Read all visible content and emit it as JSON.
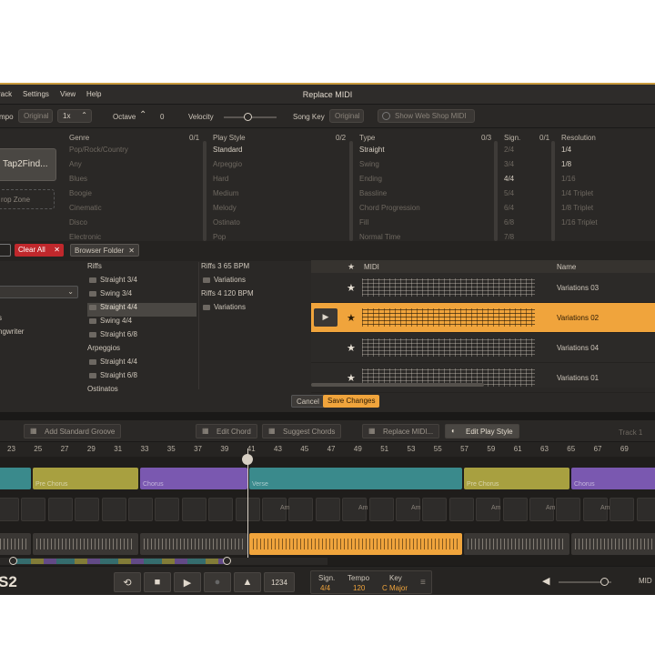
{
  "menu": [
    "rack",
    "Settings",
    "View",
    "Help"
  ],
  "dialog_title": "Replace MIDI",
  "options": {
    "tempo_label": "mpo",
    "tempo_value": "Original",
    "tempo_mult": "1x",
    "octave_label": "Octave",
    "octave_value": "0",
    "velocity_label": "Velocity",
    "velocity_level": 0.45,
    "song_key_label": "Song Key",
    "song_key_value": "Original",
    "web_shop": "Show Web Shop MIDI"
  },
  "left_panel": {
    "tap_button": "Tap2Find...",
    "drop_zone": "rop Zone"
  },
  "columns": [
    {
      "title": "Genre",
      "count": "0/1",
      "items": [
        "Pop/Rock/Country",
        "Any",
        "Blues",
        "Boogie",
        "Cinematic",
        "Disco",
        "Electronic"
      ],
      "active": []
    },
    {
      "title": "Play Style",
      "count": "0/2",
      "items": [
        "Standard",
        "Arpeggio",
        "Hard",
        "Medium",
        "Melody",
        "Ostinato",
        "Pop"
      ],
      "active": [
        0
      ]
    },
    {
      "title": "Type",
      "count": "0/3",
      "items": [
        "Straight",
        "Swing",
        "Ending",
        "Bassline",
        "Chord Progression",
        "Fill",
        "Normal Time"
      ],
      "active": [
        0
      ]
    },
    {
      "title": "Sign.",
      "count": "0/1",
      "items": [
        "2/4",
        "3/4",
        "4/4",
        "5/4",
        "6/4",
        "6/8",
        "7/8"
      ],
      "active": [
        2
      ]
    },
    {
      "title": "Resolution",
      "count": "",
      "items": [
        "1/4",
        "1/8",
        "1/16",
        "1/4 Triplet",
        "1/8 Triplet",
        "1/16 Triplet"
      ],
      "active": [
        0,
        1
      ]
    }
  ],
  "filter": {
    "clear_all": "Clear All",
    "browser_folder": "Browser Folder"
  },
  "left_tree": [
    "s",
    "ngwriter"
  ],
  "folder_tree": [
    {
      "label": "Riffs",
      "level": 0,
      "folder": false,
      "selected": false
    },
    {
      "label": "Straight 3/4",
      "level": 1,
      "folder": true,
      "selected": false
    },
    {
      "label": "Swing 3/4",
      "level": 1,
      "folder": true,
      "selected": false
    },
    {
      "label": "Straight 4/4",
      "level": 1,
      "folder": true,
      "selected": true
    },
    {
      "label": "Swing 4/4",
      "level": 1,
      "folder": true,
      "selected": false
    },
    {
      "label": "Straight 6/8",
      "level": 1,
      "folder": true,
      "selected": false
    },
    {
      "label": "Arpeggios",
      "level": 0,
      "folder": false,
      "selected": false
    },
    {
      "label": "Straight 4/4",
      "level": 1,
      "folder": true,
      "selected": false
    },
    {
      "label": "Straight 6/8",
      "level": 1,
      "folder": true,
      "selected": false
    },
    {
      "label": "Ostinatos",
      "level": 0,
      "folder": false,
      "selected": false
    }
  ],
  "riffs_tree": [
    {
      "label": "Riffs 3 65 BPM",
      "folder": false
    },
    {
      "label": "Variations",
      "folder": true
    },
    {
      "label": "Riffs 4 120 BPM",
      "folder": false
    },
    {
      "label": "Variations",
      "folder": true
    }
  ],
  "midi_list": {
    "col_midi": "MIDI",
    "col_name": "Name",
    "rows": [
      {
        "name": "Variations 03",
        "selected": false
      },
      {
        "name": "Variations 02",
        "selected": true
      },
      {
        "name": "Variations 04",
        "selected": false
      },
      {
        "name": "Variations 01",
        "selected": false
      }
    ]
  },
  "dialog_buttons": {
    "cancel": "Cancel",
    "save": "Save Changes"
  },
  "toolbar": {
    "add_groove": "Add Standard Groove",
    "edit_chord": "Edit Chord",
    "suggest": "Suggest Chords",
    "replace": "Replace MIDI...",
    "edit_play_style": "Edit Play Style",
    "track": "Track 1"
  },
  "ruler": [
    "23",
    "25",
    "27",
    "29",
    "31",
    "33",
    "35",
    "37",
    "39",
    "41",
    "43",
    "45",
    "47",
    "49",
    "51",
    "53",
    "55",
    "57",
    "59",
    "61",
    "63",
    "65",
    "67",
    "69"
  ],
  "sections": [
    {
      "label": "",
      "color": "#3a8a8c"
    },
    {
      "label": "Pre Chorus",
      "color": "#a8a040"
    },
    {
      "label": "Chorus",
      "color": "#7a58b0"
    },
    {
      "label": "Verse",
      "color": "#3a8a8c"
    },
    {
      "label": "Pre Chorus",
      "color": "#a8a040"
    },
    {
      "label": "Chorus",
      "color": "#7a58b0"
    }
  ],
  "chord_labels": [
    "Am",
    "Am",
    "Am",
    "Am",
    "Am",
    "Am"
  ],
  "transport": {
    "brand": "S2",
    "count_in": "1234",
    "sign_label": "Sign.",
    "sign_value": "4/4",
    "tempo_label": "Tempo",
    "tempo_value": "120",
    "key_label": "Key",
    "key_value": "C Major",
    "midi": "MID"
  }
}
